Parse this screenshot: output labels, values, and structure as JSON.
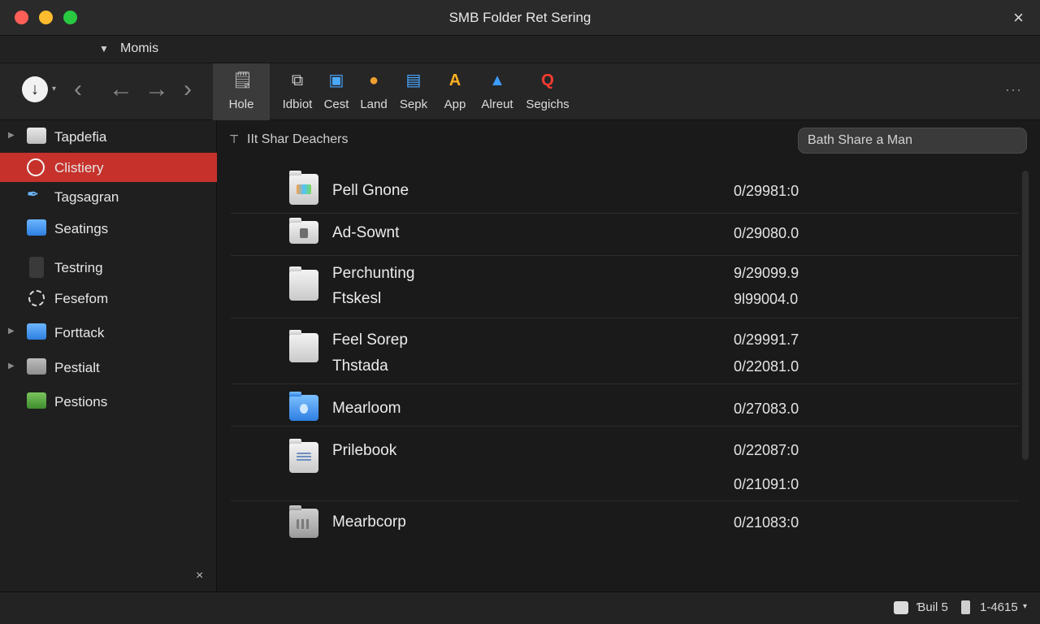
{
  "window": {
    "title": "SMB Folder Ret Sering",
    "close_icon": "×"
  },
  "location": {
    "label": "Momis"
  },
  "toolbar": {
    "nav_down_icon": "↓",
    "nav_back_icon": "‹",
    "nav_back2_icon": "←",
    "nav_forward_icon": "→",
    "nav_forward2_icon": "›",
    "more_icon": "···",
    "tools": [
      {
        "label": "Hole",
        "icon": "🗒",
        "color": "#d0d0d0"
      },
      {
        "label": "Idbiot",
        "icon": "⧉",
        "color": "#d0d0d0"
      },
      {
        "label": "Cest",
        "icon": "▣",
        "color": "#4aa8ff"
      },
      {
        "label": "Land",
        "icon": "●",
        "color": "#f0a030"
      },
      {
        "label": "Sepk",
        "icon": "▤",
        "color": "#4aa8ff"
      },
      {
        "label": "App",
        "icon": "A",
        "color": "#ffb020"
      },
      {
        "label": "Alreut",
        "icon": "▲",
        "color": "#3c9cff"
      },
      {
        "label": "Segichs",
        "icon": "Q",
        "color": "#ff3b30"
      }
    ]
  },
  "sidebar": {
    "items": [
      {
        "label": "Tapdefia",
        "icon": "folder-icon",
        "selected": false,
        "disclosure": true
      },
      {
        "label": "Clistiery",
        "icon": "history-icon",
        "selected": true,
        "disclosure": false
      },
      {
        "label": "Tagsagran",
        "icon": "tools-icon",
        "selected": false,
        "disclosure": false
      },
      {
        "label": "Seatings",
        "icon": "folder-icon",
        "selected": false,
        "disclosure": false
      },
      {
        "label": "Testring",
        "icon": "document-icon",
        "selected": false,
        "disclosure": false
      },
      {
        "label": "Fesefom",
        "icon": "gear-icon",
        "selected": false,
        "disclosure": false
      },
      {
        "label": "Forttack",
        "icon": "folder-icon",
        "selected": false,
        "disclosure": true
      },
      {
        "label": "Pestialt",
        "icon": "folder-icon",
        "selected": false,
        "disclosure": true
      },
      {
        "label": "Pestions",
        "icon": "folder-icon",
        "selected": false,
        "disclosure": false
      }
    ],
    "close_icon": "×"
  },
  "main": {
    "header_icon": "⊤",
    "header": "IIt Shar Deachers",
    "search": {
      "placeholder": "Bath Share a Man"
    },
    "files": [
      {
        "name": "Pell Gnone",
        "value": "0/29981:0",
        "icon": "folder-icon"
      },
      {
        "name": "Ad-Sownt",
        "value": "0/29080.0",
        "icon": "folder-icon"
      },
      {
        "name": "Perchunting",
        "value": "9/29099.9",
        "icon": "folder-icon"
      },
      {
        "name": "Ftskesl",
        "value": "9l99004.0",
        "icon": ""
      },
      {
        "name": "Feel Sorep",
        "value": "0/29991.7",
        "icon": "folder-icon"
      },
      {
        "name": "Thstada",
        "value": "0/22081.0",
        "icon": ""
      },
      {
        "name": "Mearloom",
        "value": "0/27083.0",
        "icon": "folder-icon"
      },
      {
        "name": "Prilebook",
        "value": "0/22087:0",
        "icon": "folder-icon"
      },
      {
        "name": "",
        "value": "0/21091:0",
        "icon": ""
      },
      {
        "name": "Mearbcorp",
        "value": "0/21083:0",
        "icon": "folder-icon"
      }
    ]
  },
  "status": {
    "disk_label": "Ɓuil 5",
    "count": "1-4615",
    "caret": "▾"
  }
}
